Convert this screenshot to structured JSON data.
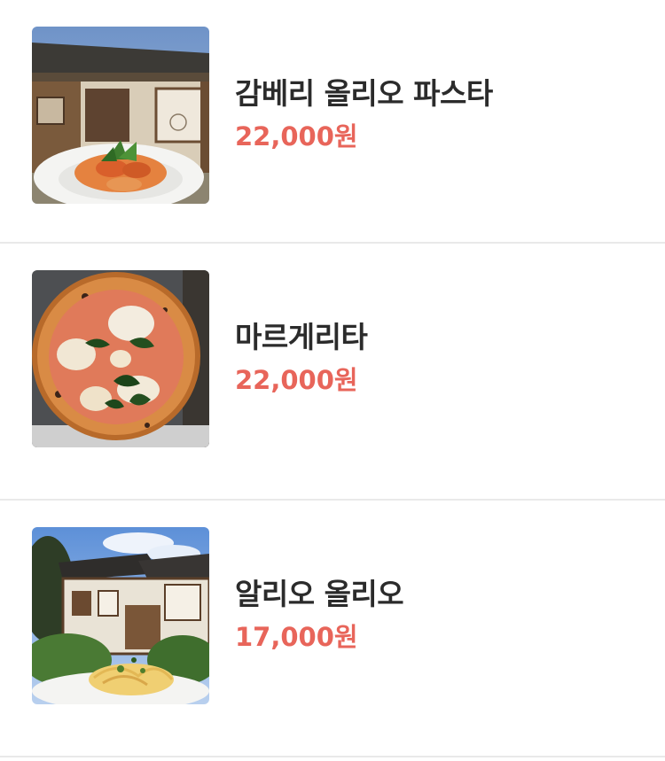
{
  "menu": {
    "items": [
      {
        "name": "감베리 올리오 파스타",
        "price": "22,000원",
        "image_icon": "shrimp-pasta-photo"
      },
      {
        "name": "마르게리타",
        "price": "22,000원",
        "image_icon": "margherita-pizza-photo"
      },
      {
        "name": "알리오 올리오",
        "price": "17,000원",
        "image_icon": "aglio-olio-photo"
      }
    ],
    "price_color": "#e8655a"
  }
}
